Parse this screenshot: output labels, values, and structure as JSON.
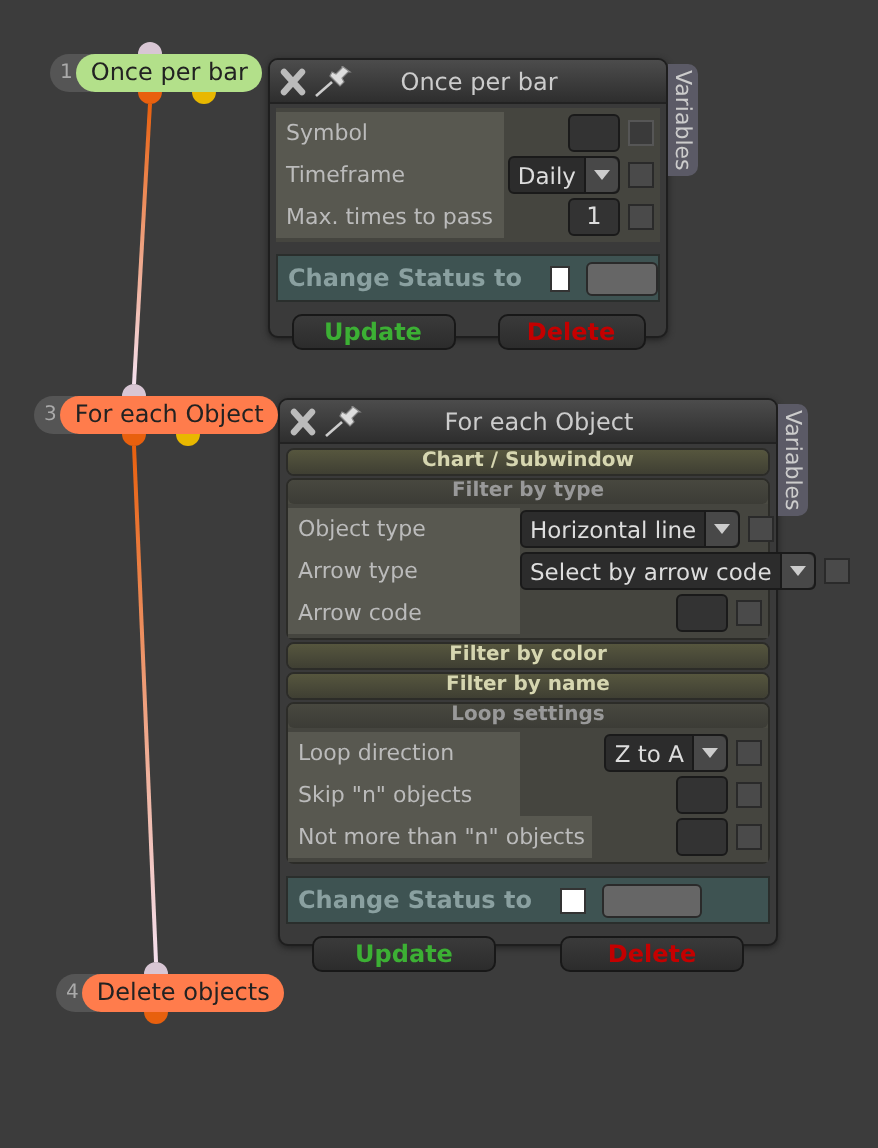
{
  "nodes": [
    {
      "number": "1",
      "label": "Once per bar",
      "color": "#b3e08a",
      "ports": [
        {
          "kind": "input",
          "color": "#d8c6d4"
        },
        {
          "kind": "output",
          "color": "#e8600e"
        },
        {
          "kind": "output",
          "color": "#e8b800"
        }
      ]
    },
    {
      "number": "3",
      "label": "For each Object",
      "color": "#ff7c4c",
      "ports": [
        {
          "kind": "input",
          "color": "#d8c6d4"
        },
        {
          "kind": "output",
          "color": "#e8600e"
        },
        {
          "kind": "output",
          "color": "#e8b800"
        }
      ]
    },
    {
      "number": "4",
      "label": "Delete objects",
      "color": "#ff7c4c",
      "ports": [
        {
          "kind": "input",
          "color": "#d8c6d4"
        },
        {
          "kind": "output",
          "color": "#e8600e"
        }
      ]
    }
  ],
  "panels": [
    {
      "title": "Once per bar",
      "variables_tab": "Variables",
      "sections": [
        {
          "rows": [
            {
              "label": "Symbol",
              "kind": "input",
              "value": "",
              "checked": false,
              "disabled": true
            },
            {
              "label": "Timeframe",
              "kind": "select",
              "value": "Daily",
              "checked": false,
              "disabled": false
            },
            {
              "label": "Max. times to pass",
              "kind": "input",
              "value": "1",
              "checked": false,
              "disabled": false
            }
          ]
        }
      ],
      "change_status": {
        "label": "Change Status to",
        "checked": false
      },
      "buttons": [
        {
          "kind": "update",
          "label": "Update"
        },
        {
          "kind": "delete",
          "label": "Delete"
        }
      ]
    },
    {
      "title": "For each Object",
      "variables_tab": "Variables",
      "sections": [
        {
          "heading": "Chart / Subwindow",
          "expanded": false
        },
        {
          "heading": "Filter by type",
          "expanded": true,
          "rows": [
            {
              "label": "Object type",
              "kind": "select",
              "value": "Horizontal line",
              "checked": false,
              "disabled": false
            },
            {
              "label": "Arrow type",
              "kind": "select",
              "value": "Select by arrow code",
              "checked": false,
              "disabled": false
            },
            {
              "label": "Arrow code",
              "kind": "input",
              "value": "",
              "checked": false,
              "disabled": false
            }
          ]
        },
        {
          "heading": "Filter by color",
          "expanded": false
        },
        {
          "heading": "Filter by name",
          "expanded": false
        },
        {
          "heading": "Loop settings",
          "expanded": true,
          "rows": [
            {
              "label": "Loop direction",
              "kind": "select",
              "value": "Z to A",
              "checked": false,
              "disabled": false
            },
            {
              "label": "Skip \"n\" objects",
              "kind": "input",
              "value": "",
              "checked": false,
              "disabled": false
            },
            {
              "label": "Not more than \"n\" objects",
              "kind": "input",
              "value": "",
              "checked": false,
              "disabled": false
            }
          ]
        }
      ],
      "change_status": {
        "label": "Change Status to",
        "checked": false
      },
      "buttons": [
        {
          "kind": "update",
          "label": "Update"
        },
        {
          "kind": "delete",
          "label": "Delete"
        }
      ]
    }
  ]
}
